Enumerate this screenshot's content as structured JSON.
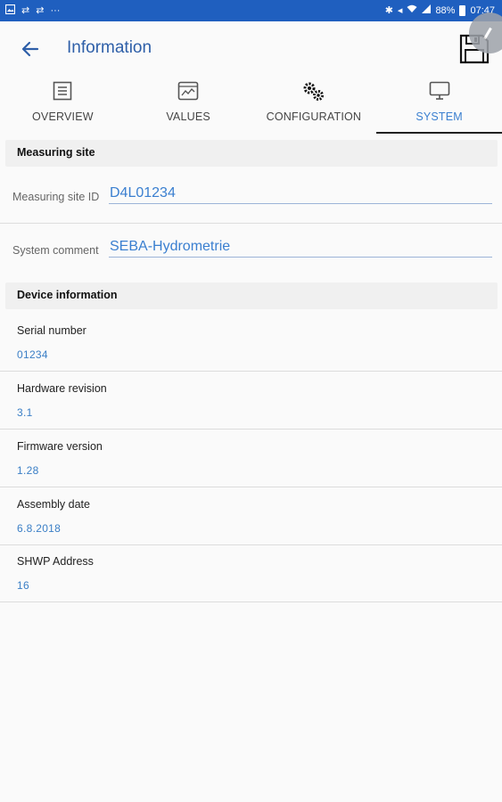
{
  "status_bar": {
    "left_icons": [
      "gallery-icon",
      "sync-icon",
      "sync-icon",
      "more-icon"
    ],
    "battery_percent": "88%",
    "time": "07:47"
  },
  "app_bar": {
    "title": "Information"
  },
  "tabs": [
    {
      "label": "OVERVIEW",
      "icon": "list-icon",
      "active": false
    },
    {
      "label": "VALUES",
      "icon": "chart-window-icon",
      "active": false
    },
    {
      "label": "CONFIGURATION",
      "icon": "gears-icon",
      "active": false
    },
    {
      "label": "SYSTEM",
      "icon": "monitor-icon",
      "active": true
    }
  ],
  "measuring_site": {
    "header": "Measuring site",
    "site_id_label": "Measuring site ID",
    "site_id_value": "D4L01234",
    "comment_label": "System comment",
    "comment_value": "SEBA-Hydrometrie"
  },
  "device_information": {
    "header": "Device information",
    "items": [
      {
        "label": "Serial number",
        "value": "01234"
      },
      {
        "label": "Hardware revision",
        "value": "3.1"
      },
      {
        "label": "Firmware version",
        "value": "1.28"
      },
      {
        "label": "Assembly date",
        "value": "6.8.2018"
      },
      {
        "label": "SHWP Address",
        "value": "16"
      }
    ]
  },
  "colors": {
    "status_bar": "#1f5fbf",
    "accent": "#3a7fd0",
    "title": "#2e5fa8"
  }
}
